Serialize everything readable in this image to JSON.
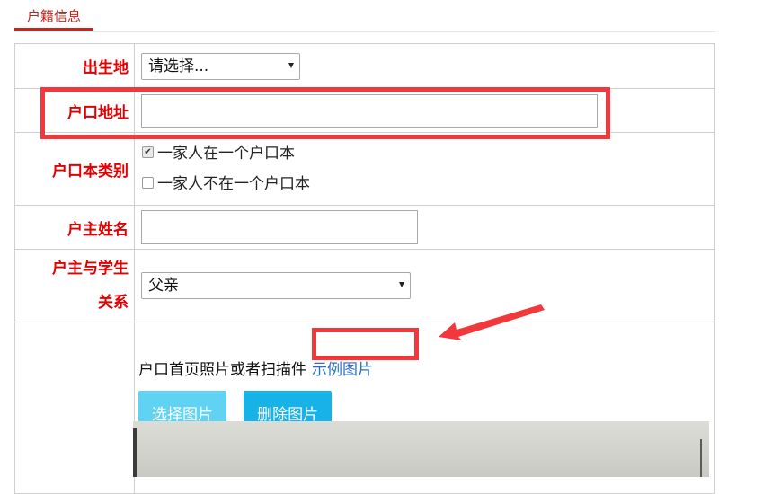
{
  "tab": {
    "label": "户籍信息"
  },
  "form": {
    "birthplace": {
      "label": "出生地",
      "select_value": "请选择..."
    },
    "address": {
      "label": "户口地址",
      "value": ""
    },
    "book_type": {
      "label": "户口本类别",
      "options": [
        {
          "label": "一家人在一个户口本",
          "checked": true
        },
        {
          "label": "一家人不在一个户口本",
          "checked": false
        }
      ]
    },
    "householder_name": {
      "label": "户主姓名",
      "value": ""
    },
    "relation": {
      "label_line1": "户主与学生",
      "label_line2": "关系",
      "select_value": "父亲"
    },
    "photo": {
      "hint": "户口首页照片或者扫描件",
      "example_link": "示例图片",
      "select_button": "选择图片",
      "delete_button": "删除图片"
    }
  },
  "colors": {
    "accent": "#c9251e",
    "label_red": "#e30000",
    "highlight": "#f2383a",
    "button_light": "#5fd3f1",
    "button_primary": "#17b2e8",
    "link": "#2a6fc4"
  }
}
